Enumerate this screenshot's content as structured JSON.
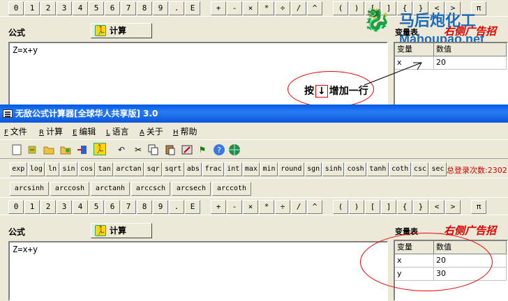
{
  "window": {
    "title": "无敌公式计算器[全球华人共享版] 3.0"
  },
  "watermark": {
    "brand": "马后炮化工",
    "url": "Mahoupao.net"
  },
  "keypad": [
    "0",
    "1",
    "2",
    "3",
    "4",
    "5",
    "6",
    "7",
    "8",
    "9",
    ".",
    "E",
    "+",
    "-",
    "×",
    "*",
    "÷",
    "/",
    "^",
    "(",
    ")",
    "[",
    "]",
    "{",
    "}",
    "<",
    ">",
    "π"
  ],
  "formula": {
    "label": "公式",
    "calc_button": "计算",
    "expression": "Z=x+y"
  },
  "variables": {
    "label": "变量表",
    "ad_text": "右侧广告招",
    "col_name": "变量",
    "col_value": "数值",
    "top_rows": [
      {
        "name": "x",
        "value": "20"
      }
    ],
    "bottom_rows": [
      {
        "name": "x",
        "value": "20"
      },
      {
        "name": "y",
        "value": "30"
      }
    ]
  },
  "hint": {
    "text_before": "按",
    "arrow": "↓",
    "text_after": "增加一行"
  },
  "menu": [
    {
      "key": "F",
      "label": "文件"
    },
    {
      "key": "R",
      "label": "计算"
    },
    {
      "key": "E",
      "label": "编辑"
    },
    {
      "key": "L",
      "label": "语言"
    },
    {
      "key": "A",
      "label": "关于"
    },
    {
      "key": "H",
      "label": "帮助"
    }
  ],
  "functions_row1": [
    "exp",
    "log",
    "ln",
    "sin",
    "cos",
    "tan",
    "arctan",
    "sqr",
    "sqrt",
    "abs",
    "frac",
    "int",
    "max",
    "min",
    "round",
    "sgn",
    "sinh",
    "cosh",
    "tanh",
    "coth",
    "csc",
    "sec"
  ],
  "functions_row2": [
    "arcsinh",
    "arccosh",
    "arctanh",
    "arccsch",
    "arcsech",
    "arccoth"
  ],
  "login_count": "总登录次数:2302",
  "colors": {
    "ad_red": "#e00000",
    "title_blue": "#0058e6"
  }
}
